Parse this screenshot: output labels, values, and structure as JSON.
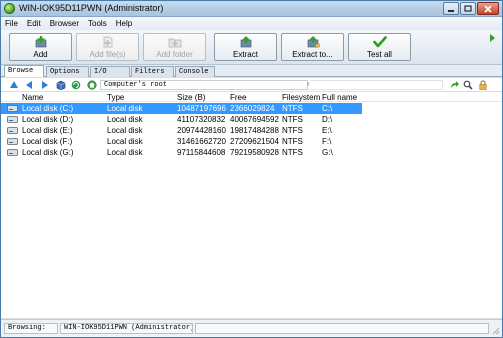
{
  "window": {
    "title": "WIN-IOK95D11PWN (Administrator)",
    "colors": {
      "titlebar": "#b2cce4",
      "selection": "#3399ff",
      "accent_green": "#4aa020"
    }
  },
  "menu": [
    "File",
    "Edit",
    "Browser",
    "Tools",
    "Help"
  ],
  "toolbar": {
    "buttons": [
      {
        "label": "Add",
        "icon": "add-icon",
        "enabled": true
      },
      {
        "label": "Add file(s)",
        "icon": "add-files-icon",
        "enabled": false
      },
      {
        "label": "Add folder",
        "icon": "add-folder-icon",
        "enabled": false
      },
      {
        "label": "Extract",
        "icon": "extract-icon",
        "enabled": true
      },
      {
        "label": "Extract to...",
        "icon": "extract-to-icon",
        "enabled": true
      },
      {
        "label": "Test all",
        "icon": "test-all-icon",
        "enabled": true
      }
    ],
    "more_icon": "chevron-right-icon"
  },
  "tabs": [
    "Browse",
    "Options",
    "I/O",
    "Filters",
    "Console"
  ],
  "active_tab": "Browse",
  "address": {
    "path": "Computer's root",
    "nav_icons": [
      "up-icon",
      "back-icon",
      "forward-icon",
      "cube-icon",
      "refresh-icon",
      "home-icon"
    ],
    "right_icons": [
      "go-icon",
      "search-icon",
      "lock-icon"
    ]
  },
  "columns": [
    "Name",
    "Type",
    "Size (B)",
    "Free",
    "Filesystem",
    "Full name"
  ],
  "rows": [
    {
      "name": "Local disk (C:)",
      "type": "Local disk",
      "size": "10487197696",
      "free": "2366029824",
      "fs": "NTFS",
      "full": "C:\\",
      "selected": true
    },
    {
      "name": "Local disk (D:)",
      "type": "Local disk",
      "size": "41107320832",
      "free": "40067694592",
      "fs": "NTFS",
      "full": "D:\\",
      "selected": false
    },
    {
      "name": "Local disk (E:)",
      "type": "Local disk",
      "size": "20974428160",
      "free": "19817484288",
      "fs": "NTFS",
      "full": "E:\\",
      "selected": false
    },
    {
      "name": "Local disk (F:)",
      "type": "Local disk",
      "size": "31461662720",
      "free": "27209621504",
      "fs": "NTFS",
      "full": "F:\\",
      "selected": false
    },
    {
      "name": "Local disk (G:)",
      "type": "Local disk",
      "size": "97115844608",
      "free": "79219580928",
      "fs": "NTFS",
      "full": "G:\\",
      "selected": false
    }
  ],
  "status": {
    "label": "Browsing:",
    "value": "WIN-IOK95D11PWN (Administrator)"
  }
}
